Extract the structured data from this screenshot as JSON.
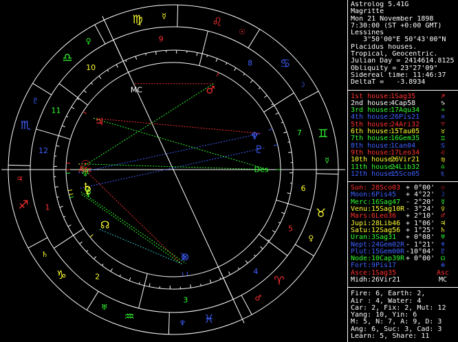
{
  "header": {
    "app": "Astrolog 5.41G",
    "name": "Magritte",
    "date": "Mon 21 November 1898",
    "time": "7:30:00 (ST +0:00 GMT)",
    "place": "Lessines",
    "coords": "3°50'00\"E 50°43'00\"N",
    "system": "Placidus houses.",
    "zodiac": "Tropical, Geocentric.",
    "julian": "Julian Day = 2414614.8125",
    "obliquity": "Obliquity = 23°27'09\"",
    "sidereal": "Sidereal time: 11:46:37",
    "deltat": "DeltaT =   -3.8934"
  },
  "houses": [
    {
      "label": "1st house:",
      "value": "1Sag35",
      "sym": "♐",
      "color": "#ff3030"
    },
    {
      "label": "2nd house:",
      "value": "4Cap58",
      "sym": "♑",
      "color": "#ffffff"
    },
    {
      "label": "3rd house:",
      "value": "17Aqu34",
      "sym": "♒",
      "color": "#30ff30"
    },
    {
      "label": "4th house:",
      "value": "26Pis21",
      "sym": "♓",
      "color": "#4060ff"
    },
    {
      "label": "5th house:",
      "value": "24Ari32",
      "sym": "♈",
      "color": "#ff3030"
    },
    {
      "label": "6th house:",
      "value": "15Tau05",
      "sym": "♉",
      "color": "#ffff30"
    },
    {
      "label": "7th house:",
      "value": "16Gem35",
      "sym": "♊",
      "color": "#30ff30"
    },
    {
      "label": "8th house:",
      "value": "1Can04",
      "sym": "♋",
      "color": "#4060ff"
    },
    {
      "label": "9th house:",
      "value": "17Leo34",
      "sym": "♌",
      "color": "#ff3030"
    },
    {
      "label": "10th house:",
      "value": "26Vir21",
      "sym": "♍",
      "color": "#ffff30"
    },
    {
      "label": "11th house:",
      "value": "24Lib32",
      "sym": "♎",
      "color": "#30ff30"
    },
    {
      "label": "12th house:",
      "value": "15Sco05",
      "sym": "♏",
      "color": "#4060ff"
    }
  ],
  "planets": [
    {
      "label": "Sun:",
      "value": "28Sco03",
      "lat": "+ 0°00'",
      "sym": "☉",
      "color": "#ff3030"
    },
    {
      "label": "Moon:",
      "value": "6Pis45",
      "lat": "+ 4°22'",
      "sym": "☽",
      "color": "#4060ff"
    },
    {
      "label": "Merc:",
      "value": "16Sag47",
      "lat": "- 2°20'",
      "sym": "☿",
      "color": "#30ff30"
    },
    {
      "label": "Venu:",
      "value": "15Sag10R",
      "lat": "- 3°24'",
      "sym": "♀",
      "color": "#ffff30"
    },
    {
      "label": "Mars:",
      "value": "6Leo36",
      "lat": "+ 2°10'",
      "sym": "♂",
      "color": "#ff3030"
    },
    {
      "label": "Jupi:",
      "value": "28Lib46",
      "lat": "+ 1°06'",
      "sym": "♃",
      "color": "#ffff30"
    },
    {
      "label": "Satu:",
      "value": "12Sag56",
      "lat": "+ 1°25'",
      "sym": "♄",
      "color": "#ffff30"
    },
    {
      "label": "Uran:",
      "value": "3Sag31",
      "lat": "+ 0°08'",
      "sym": "♅",
      "color": "#30ff30"
    },
    {
      "label": "Nept:",
      "value": "24Gem02R",
      "lat": "- 1°21'",
      "sym": "♆",
      "color": "#4060ff"
    },
    {
      "label": "Plut:",
      "value": "15Gem00R",
      "lat": "-10°04'",
      "sym": "♇",
      "color": "#4060ff"
    },
    {
      "label": "Node:",
      "value": "10Cap39R",
      "lat": "+ 0°00'",
      "sym": "☊",
      "color": "#30ff30"
    },
    {
      "label": "Fort:",
      "value": "9Pis17",
      "lat": "",
      "sym": "⊗",
      "color": "#4060ff"
    },
    {
      "label": "Asce:",
      "value": "1Sag35",
      "lat": "",
      "sym": "Asc",
      "color": "#ff3030"
    },
    {
      "label": "Midh:",
      "value": "26Vir21",
      "lat": "",
      "sym": "MC",
      "color": "#ffffff"
    }
  ],
  "summary": [
    "Fire: 6, Earth: 2,",
    "Air : 4, Water: 4",
    "Car: 2, Fix: 2, Mut: 12",
    "Yang: 10, Yin: 6",
    "M: 5, N: 7, A: 9, D: 3",
    "Ang: 6, Suc: 3, Cad: 3",
    "Learn: 5, Share: 11"
  ],
  "wheel": {
    "asc_longitude": 241.58,
    "house_cusps": [
      241.58,
      274.97,
      317.57,
      356.35,
      24.53,
      45.08,
      61.58,
      94.07,
      137.57,
      176.35,
      204.53,
      225.08
    ],
    "signs": [
      {
        "name": "aries",
        "sym": "♈",
        "color": "#ff3030"
      },
      {
        "name": "taurus",
        "sym": "♉",
        "color": "#ffff30"
      },
      {
        "name": "gemini",
        "sym": "♊",
        "color": "#30ff30"
      },
      {
        "name": "cancer",
        "sym": "♋",
        "color": "#4060ff"
      },
      {
        "name": "leo",
        "sym": "♌",
        "color": "#ff3030"
      },
      {
        "name": "virgo",
        "sym": "♍",
        "color": "#ffff30"
      },
      {
        "name": "libra",
        "sym": "♎",
        "color": "#30ff30"
      },
      {
        "name": "scorpio",
        "sym": "♏",
        "color": "#4060ff"
      },
      {
        "name": "sagittarius",
        "sym": "♐",
        "color": "#ff3030"
      },
      {
        "name": "capricorn",
        "sym": "♑",
        "color": "#ffff30"
      },
      {
        "name": "aquarius",
        "sym": "♒",
        "color": "#30ff30"
      },
      {
        "name": "pisces",
        "sym": "♓",
        "color": "#4060ff"
      }
    ],
    "rulers": [
      {
        "sym": "♂",
        "color": "#ff3030"
      },
      {
        "sym": "♀",
        "color": "#ffff30"
      },
      {
        "sym": "☿",
        "color": "#30ff30"
      },
      {
        "sym": "☽",
        "color": "#4060ff"
      },
      {
        "sym": "☉",
        "color": "#ff3030"
      },
      {
        "sym": "☿",
        "color": "#ffff30"
      },
      {
        "sym": "♀",
        "color": "#30ff30"
      },
      {
        "sym": "♇",
        "color": "#4060ff"
      },
      {
        "sym": "♃",
        "color": "#ff3030"
      },
      {
        "sym": "♄",
        "color": "#ffff30"
      },
      {
        "sym": "♅",
        "color": "#30ff30"
      },
      {
        "sym": "♆",
        "color": "#4060ff"
      }
    ],
    "house_numbers": [
      "1",
      "2",
      "3",
      "4",
      "5",
      "6",
      "7",
      "8",
      "9",
      "10",
      "11",
      "12"
    ],
    "house_number_colors": [
      "#ff3030",
      "#ffff30",
      "#30ff30",
      "#4060ff",
      "#ff3030",
      "#ffff30",
      "#30ff30",
      "#4060ff",
      "#ff3030",
      "#ffff30",
      "#30ff30",
      "#4060ff"
    ],
    "bodies": [
      {
        "name": "sun",
        "sym": "☉",
        "lon": 238.05,
        "color": "#ff3030"
      },
      {
        "name": "moon",
        "sym": "☽",
        "lon": 336.75,
        "color": "#4060ff"
      },
      {
        "name": "mercury",
        "sym": "☿",
        "lon": 256.78,
        "color": "#30ff30"
      },
      {
        "name": "venus",
        "sym": "♀",
        "lon": 255.17,
        "color": "#ffff30"
      },
      {
        "name": "mars",
        "sym": "♂",
        "lon": 126.6,
        "color": "#ff3030"
      },
      {
        "name": "jupiter",
        "sym": "♃",
        "lon": 208.77,
        "color": "#ff3030"
      },
      {
        "name": "saturn",
        "sym": "♄",
        "lon": 252.93,
        "color": "#ffff30"
      },
      {
        "name": "uranus",
        "sym": "♅",
        "lon": 243.52,
        "color": "#30ff30"
      },
      {
        "name": "neptune",
        "sym": "♆",
        "lon": 84.03,
        "color": "#4060ff"
      },
      {
        "name": "pluto",
        "sym": "♇",
        "lon": 75.0,
        "color": "#4060ff"
      },
      {
        "name": "node",
        "sym": "☊",
        "lon": 280.65,
        "color": "#ffff30"
      },
      {
        "name": "fortune",
        "sym": "⊗",
        "lon": 339.28,
        "color": "#4060ff"
      },
      {
        "name": "mc",
        "sym": "MC",
        "lon": 176.35,
        "color": "#ffffff"
      },
      {
        "name": "asc",
        "sym": "Asc",
        "lon": 241.58,
        "color": "#ff3030"
      },
      {
        "name": "des",
        "sym": "Des",
        "lon": 61.58,
        "color": "#30ff30"
      }
    ],
    "aspects": [
      {
        "a": "sun",
        "b": "moon",
        "color": "#ff3030"
      },
      {
        "a": "mars",
        "b": "mc",
        "color": "#ff3030"
      },
      {
        "a": "mars",
        "b": "asc",
        "color": "#30ff30"
      },
      {
        "a": "jupiter",
        "b": "neptune",
        "color": "#ff3030"
      },
      {
        "a": "saturn",
        "b": "pluto",
        "color": "#4060ff"
      },
      {
        "a": "uranus",
        "b": "neptune",
        "color": "#4060ff"
      },
      {
        "a": "venus",
        "b": "fortune",
        "color": "#30ff30"
      },
      {
        "a": "mercury",
        "b": "moon",
        "color": "#30ff30"
      },
      {
        "a": "node",
        "b": "moon",
        "color": "#30c0c0"
      },
      {
        "a": "sun",
        "b": "des",
        "color": "#30ff30"
      },
      {
        "a": "jupiter",
        "b": "des",
        "color": "#30ff30"
      }
    ]
  }
}
